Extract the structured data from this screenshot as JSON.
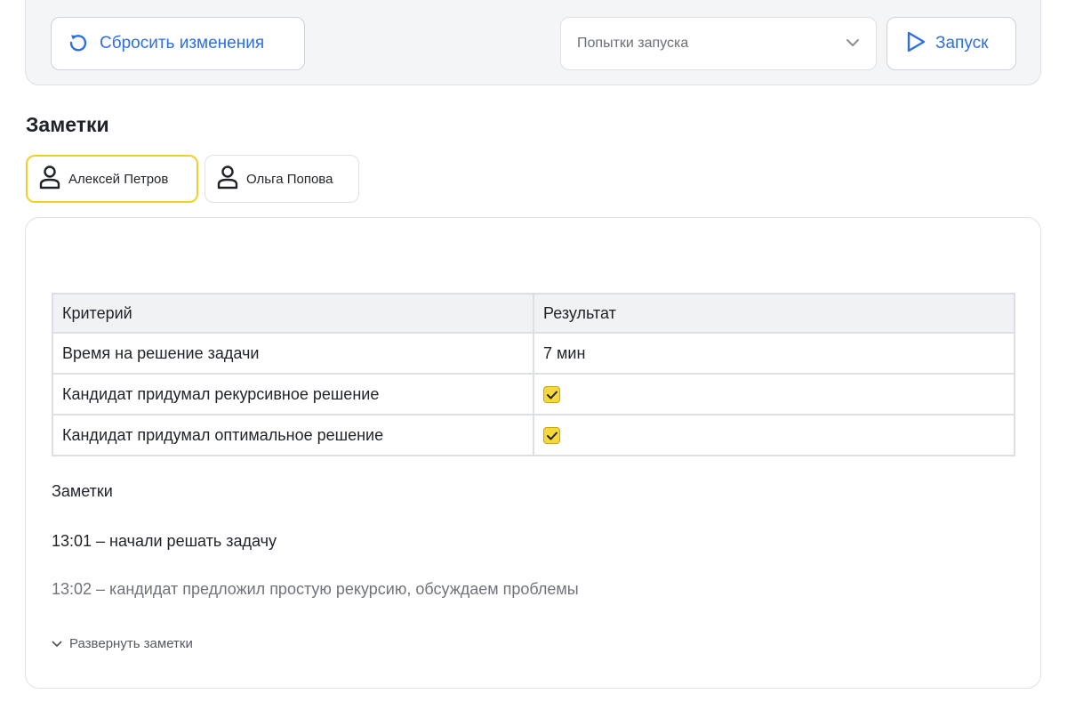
{
  "toolbar": {
    "reset_label": "Сбросить изменения",
    "attempts_select": {
      "value": "Попытки запуска"
    },
    "run_label": "Запуск",
    "accent_color": "#2f6fe0"
  },
  "notes_section": {
    "title": "Заметки",
    "tabs": [
      {
        "label": "Алексей Петров",
        "active": true,
        "icon": "user-icon"
      },
      {
        "label": "Ольга Попова",
        "active": false,
        "icon": "user-icon"
      }
    ],
    "active_tab_border_color": "#f2cf2a"
  },
  "criteria_table": {
    "headers": [
      "Критерий",
      "Результат"
    ],
    "rows": [
      {
        "criterion": "Время на решение задачи",
        "result": "7 мин",
        "checked": null
      },
      {
        "criterion": "Кандидат придумал рекурсивное решение",
        "result": "",
        "checked": true
      },
      {
        "criterion": "Кандидат придумал оптимальное решение",
        "result": "",
        "checked": true
      }
    ],
    "checkbox_color": "#f7d83b"
  },
  "notes": {
    "heading": "Заметки",
    "lines": [
      "13:01 – начали решать задачу",
      "13:02 – кандидат предложил простую рекурсию, обсуждаем проблемы"
    ],
    "expand_label": "Развернуть заметки"
  }
}
